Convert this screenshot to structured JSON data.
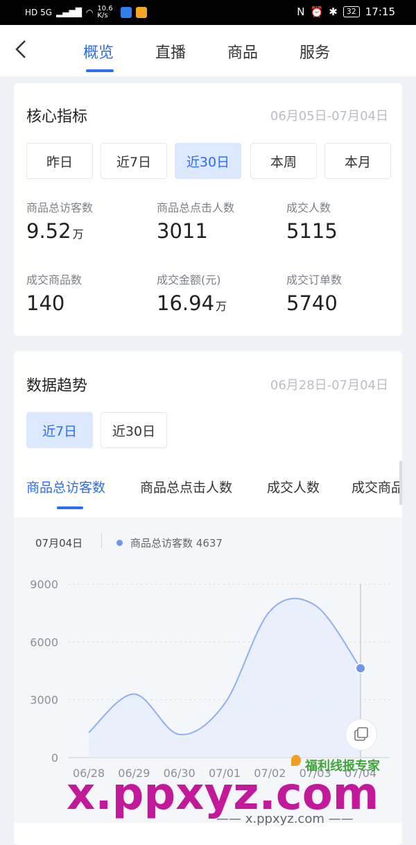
{
  "status_bar": {
    "left_text": "HD 5G",
    "speed": "10.6 K/s",
    "battery": "32",
    "time": "17:15"
  },
  "nav": {
    "tabs": [
      "概览",
      "直播",
      "商品",
      "服务"
    ],
    "active_tab": 0
  },
  "core": {
    "title": "核心指标",
    "date_range": "06月05日-07月04日",
    "periods": [
      "昨日",
      "近7日",
      "近30日",
      "本周",
      "本月"
    ],
    "active_period": 2,
    "metrics": [
      {
        "label": "商品总访客数",
        "value": "9.52",
        "unit": "万"
      },
      {
        "label": "商品总点击人数",
        "value": "3011",
        "unit": ""
      },
      {
        "label": "成交人数",
        "value": "5115",
        "unit": ""
      },
      {
        "label": "成交商品数",
        "value": "140",
        "unit": ""
      },
      {
        "label": "成交金额(元)",
        "value": "16.94",
        "unit": "万"
      },
      {
        "label": "成交订单数",
        "value": "5740",
        "unit": ""
      }
    ]
  },
  "trend": {
    "title": "数据趋势",
    "date_range": "06月28日-07月04日",
    "periods": [
      "近7日",
      "近30日"
    ],
    "active_period": 0,
    "metric_tabs": [
      "商品总访客数",
      "商品总点击人数",
      "成交人数",
      "成交商品"
    ],
    "active_metric_tab": 0,
    "tooltip": {
      "date": "07月04日",
      "series": "商品总访客数",
      "value": "4637"
    }
  },
  "chart_data": {
    "type": "area",
    "categories": [
      "06/28",
      "06/29",
      "06/30",
      "07/01",
      "07/02",
      "07/03",
      "07/04"
    ],
    "series": [
      {
        "name": "商品总访客数",
        "values": [
          1300,
          3300,
          1200,
          2800,
          7600,
          7900,
          4637
        ]
      }
    ],
    "ylim": [
      0,
      9000
    ],
    "y_ticks": [
      "9000",
      "6000",
      "3000",
      "0"
    ],
    "grid": true,
    "highlight_index": 6,
    "color": "#8fb0ee"
  },
  "watermark": {
    "brand": "福利线报专家",
    "big": "x.ppxyz.com",
    "small": "—— x.ppxyz.com ——"
  }
}
